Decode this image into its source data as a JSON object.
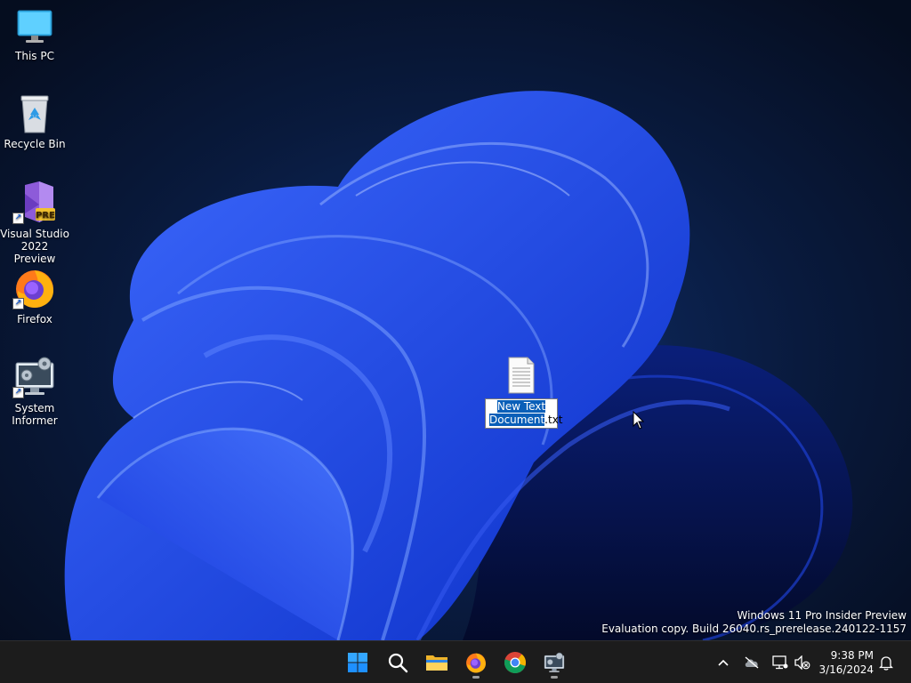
{
  "desktop": {
    "icons": [
      {
        "label": "This PC",
        "icon": "monitor-icon"
      },
      {
        "label": "Recycle Bin",
        "icon": "recycle-bin-icon"
      },
      {
        "label": "Visual Studio 2022 Preview",
        "icon": "visual-studio-preview-icon",
        "badge": "PRE"
      },
      {
        "label": "Firefox",
        "icon": "firefox-icon"
      },
      {
        "label": "System Informer",
        "icon": "system-informer-icon"
      }
    ],
    "rename_file": {
      "selected_text": "New Text Document",
      "extension": ".txt",
      "icon": "text-document-icon"
    },
    "watermark": {
      "line1": "Windows 11 Pro Insider Preview",
      "line2": "Evaluation copy. Build 26040.rs_prerelease.240122-1157"
    }
  },
  "taskbar": {
    "pinned": [
      {
        "name": "start",
        "icon": "windows-start-icon"
      },
      {
        "name": "search",
        "icon": "search-icon"
      },
      {
        "name": "file-explorer",
        "icon": "folder-icon"
      },
      {
        "name": "firefox",
        "icon": "firefox-icon",
        "running": true
      },
      {
        "name": "chrome",
        "icon": "chrome-icon"
      },
      {
        "name": "system-informer",
        "icon": "system-informer-icon",
        "running": true
      }
    ],
    "tray": [
      "chevron-up-icon",
      "onedrive-offline-icon",
      "network-icon",
      "volume-muted-icon",
      "notification-bell-icon"
    ],
    "clock": {
      "time": "9:38 PM",
      "date": "3/16/2024"
    }
  },
  "colors": {
    "accent_blue": "#1a5fff",
    "selection": "#0a5fb8",
    "taskbar_bg": "#1c1c1c"
  }
}
